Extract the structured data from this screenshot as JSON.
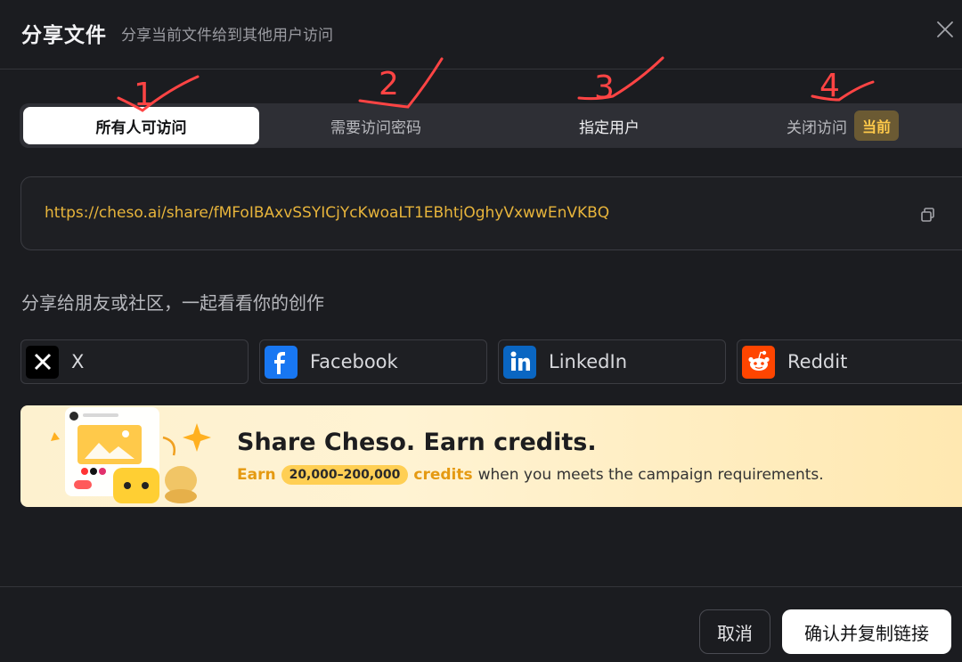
{
  "header": {
    "title": "分享文件",
    "subtitle": "分享当前文件给到其他用户访问"
  },
  "tabs": [
    {
      "label": "所有人可访问",
      "active": true
    },
    {
      "label": "需要访问密码",
      "active": false
    },
    {
      "label": "指定用户",
      "active": false
    },
    {
      "label": "关闭访问",
      "badge": "当前",
      "active": false
    }
  ],
  "annotations": [
    "1",
    "2",
    "3",
    "4"
  ],
  "share_link": "https://cheso.ai/share/fMFoIBAxvSSYICjYcKwoaLT1EBhtjOghyVxwwEnVKBQ",
  "share_label": "分享给朋友或社区，一起看看你的创作",
  "social": [
    {
      "label": "X",
      "icon": "x-logo-icon"
    },
    {
      "label": "Facebook",
      "icon": "facebook-logo-icon"
    },
    {
      "label": "LinkedIn",
      "icon": "linkedin-logo-icon"
    },
    {
      "label": "Reddit",
      "icon": "reddit-logo-icon"
    }
  ],
  "banner": {
    "title": "Share Cheso. Earn credits.",
    "earn": "Earn",
    "range": "20,000–200,000",
    "credits": "credits",
    "rest": "when you meets the campaign requirements."
  },
  "buttons": {
    "cancel": "取消",
    "confirm": "确认并复制链接"
  },
  "colors": {
    "background": "#1b1c20",
    "link": "#e7b43b",
    "badge_text": "#ffc94a",
    "annotation": "#ff4444"
  }
}
